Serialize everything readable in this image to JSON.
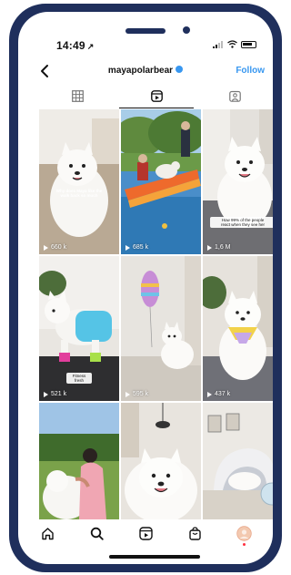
{
  "status_bar": {
    "time": "14:49",
    "location_glyph": "↗"
  },
  "header": {
    "username": "mayapolarbear",
    "follow_label": "Follow"
  },
  "tabs": [
    {
      "name": "grid",
      "icon": "grid-icon",
      "active": false
    },
    {
      "name": "reels",
      "icon": "reels-icon",
      "active": true
    },
    {
      "name": "tagged",
      "icon": "tagged-icon",
      "active": false
    }
  ],
  "posts": [
    {
      "views": "660 k",
      "caption": "Why does Maya like the\nwalk back so much",
      "scene": "samoyed-on-couch"
    },
    {
      "views": "685 k",
      "caption": "",
      "scene": "dog-on-pool-slide"
    },
    {
      "views": "1,6 M",
      "caption": "How 99% of the people\nreact when they see her",
      "scene": "samoyed-smiling-rug"
    },
    {
      "views": "521 k",
      "caption": "Fitness fresh",
      "scene": "samoyed-in-sweater"
    },
    {
      "views": "595 k",
      "caption": "",
      "scene": "samoyed-with-balloon"
    },
    {
      "views": "437 k",
      "caption": "",
      "scene": "samoyed-with-bandana"
    },
    {
      "views": "",
      "caption": "",
      "scene": "woman-hugging-samoyed"
    },
    {
      "views": "",
      "caption": "",
      "scene": "samoyed-closeup"
    },
    {
      "views": "",
      "caption": "",
      "scene": "dog-in-pet-bed"
    }
  ],
  "bottom_nav": [
    {
      "name": "home",
      "icon": "home-icon"
    },
    {
      "name": "search",
      "icon": "search-icon"
    },
    {
      "name": "reels",
      "icon": "reels-icon"
    },
    {
      "name": "shop",
      "icon": "shop-bag-icon"
    },
    {
      "name": "profile",
      "icon": "avatar"
    }
  ],
  "colors": {
    "frame": "#1f2f5c",
    "accent": "#3897f0",
    "notification": "#ff3040"
  }
}
